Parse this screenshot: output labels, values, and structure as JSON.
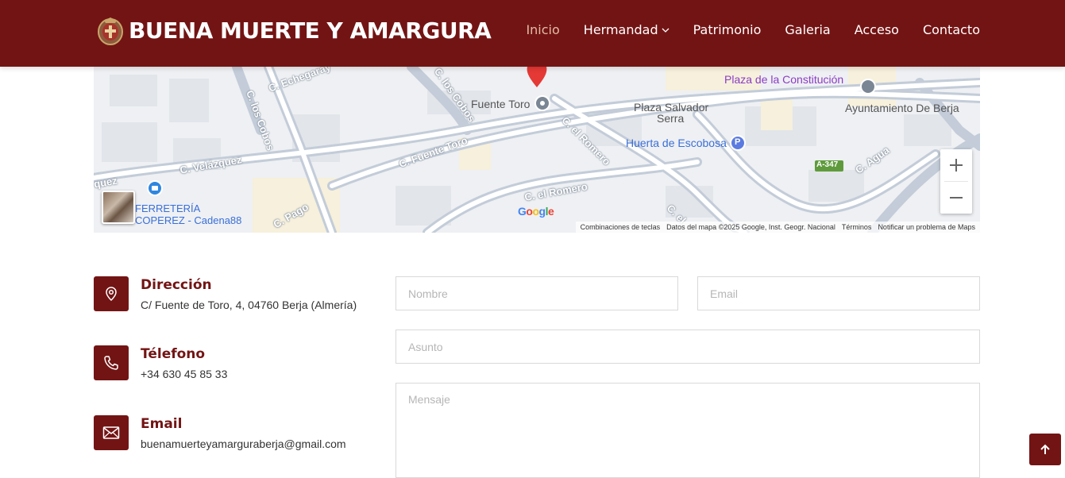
{
  "header": {
    "brand": "BUENA MUERTE Y AMARGURA",
    "nav": [
      {
        "label": "Inicio",
        "active": true
      },
      {
        "label": "Hermandad",
        "dropdown": true
      },
      {
        "label": "Patrimonio"
      },
      {
        "label": "Galeria"
      },
      {
        "label": "Acceso"
      },
      {
        "label": "Contacto"
      }
    ]
  },
  "map": {
    "streets": [
      "C. Echegaray",
      "C. los Cobos",
      "C. los Cobos",
      "C. Velázquez",
      "C. Fuente Toro",
      "C. el Romero",
      "C. el Romero",
      "C. Pago",
      "C. Agua",
      "C. el",
      "quez"
    ],
    "places": {
      "fuente_toro": "Fuente Toro",
      "plaza_constitucion": "Plaza de la Constitución",
      "plaza_salvador": "Plaza Salvador",
      "plaza_salvador_2": "Serra",
      "ayuntamiento": "Ayuntamiento De Berja",
      "huerta": "Huerta de Escobosa",
      "ferreteria_1": "FERRETERÍA",
      "ferreteria_2": "COPEREZ - Cadena88",
      "road_badge": "A-347",
      "parking": "P"
    },
    "google_logo": "Google",
    "attribution": [
      "Combinaciones de teclas",
      "Datos del mapa ©2025 Google, Inst. Geogr. Nacional",
      "Términos",
      "Notificar un problema de Maps"
    ]
  },
  "contact": {
    "address_title": "Dirección",
    "address": "C/ Fuente de Toro, 4, 04760 Berja (Almería)",
    "phone_title": "Télefono",
    "phone": "+34 630 45 85 33",
    "email_title": "Email",
    "email": "buenamuerteyamarguraberja@gmail.com"
  },
  "form": {
    "name_placeholder": "Nombre",
    "email_placeholder": "Email",
    "subject_placeholder": "Asunto",
    "message_placeholder": "Mensaje"
  },
  "colors": {
    "brand": "#731414",
    "active_nav": "#e0bca5"
  }
}
